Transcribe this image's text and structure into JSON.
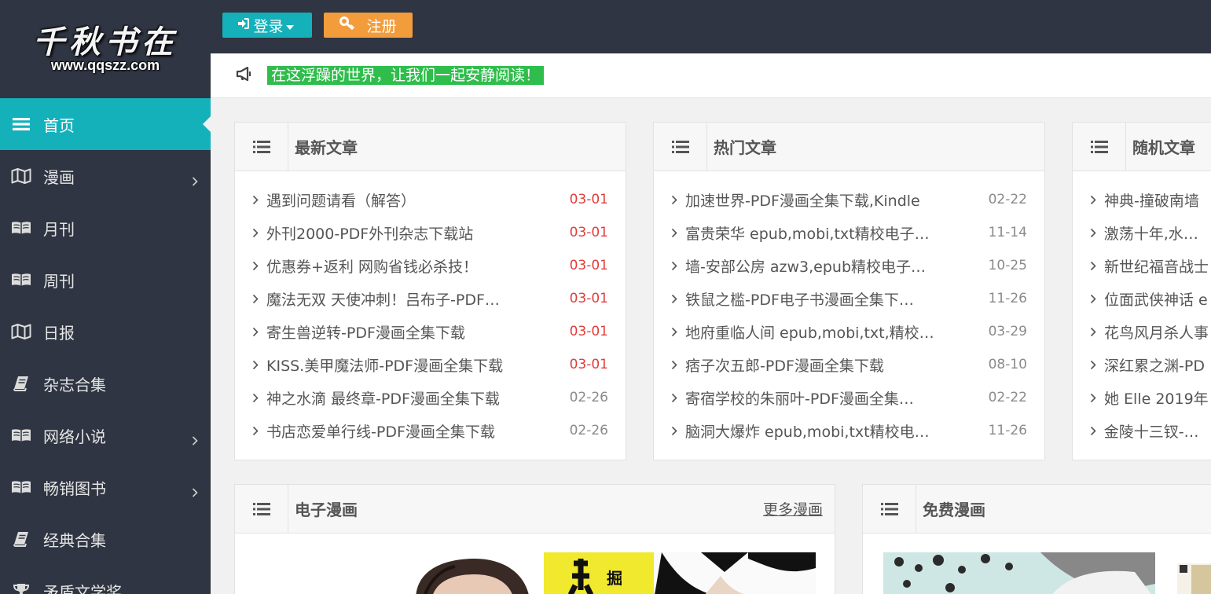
{
  "logo": {
    "title": "千秋书在",
    "url": "www.qqszz.com"
  },
  "sidebar": {
    "items": [
      {
        "label": "首页",
        "icon": "list-icon",
        "active": true,
        "submenu": false
      },
      {
        "label": "漫画",
        "icon": "map-icon",
        "active": false,
        "submenu": true
      },
      {
        "label": "月刊",
        "icon": "book-open-icon",
        "active": false,
        "submenu": false
      },
      {
        "label": "周刊",
        "icon": "book-open-icon",
        "active": false,
        "submenu": false
      },
      {
        "label": "日报",
        "icon": "map-icon",
        "active": false,
        "submenu": false
      },
      {
        "label": "杂志合集",
        "icon": "book-icon",
        "active": false,
        "submenu": false
      },
      {
        "label": "网络小说",
        "icon": "book-open-icon",
        "active": false,
        "submenu": true
      },
      {
        "label": "畅销图书",
        "icon": "book-open-icon",
        "active": false,
        "submenu": true
      },
      {
        "label": "经典合集",
        "icon": "book-icon",
        "active": false,
        "submenu": false
      },
      {
        "label": "矛盾文学奖",
        "icon": "trophy-icon",
        "active": false,
        "submenu": false
      }
    ]
  },
  "header": {
    "login_label": "登录",
    "register_label": "注册"
  },
  "notice": {
    "text": "在这浮躁的世界，让我们一起安静阅读！"
  },
  "panels": {
    "latest": {
      "title": "最新文章",
      "items": [
        {
          "title": "遇到问题请看（解答）",
          "date": "03-01",
          "recent": true
        },
        {
          "title": "外刊2000-PDF外刊杂志下载站",
          "date": "03-01",
          "recent": true
        },
        {
          "title": "优惠券+返利 网购省钱必杀技！",
          "date": "03-01",
          "recent": true
        },
        {
          "title": "魔法无双 天使冲刺！吕布子-PDF…",
          "date": "03-01",
          "recent": true
        },
        {
          "title": "寄生兽逆转-PDF漫画全集下载",
          "date": "03-01",
          "recent": true
        },
        {
          "title": "KISS.美甲魔法师-PDF漫画全集下载",
          "date": "03-01",
          "recent": true
        },
        {
          "title": "神之水滴 最终章-PDF漫画全集下载",
          "date": "02-26",
          "recent": false
        },
        {
          "title": "书店恋爱单行线-PDF漫画全集下载",
          "date": "02-26",
          "recent": false
        }
      ]
    },
    "hot": {
      "title": "热门文章",
      "items": [
        {
          "title": "加速世界-PDF漫画全集下载,Kindle",
          "date": "02-22"
        },
        {
          "title": "富贵荣华 epub,mobi,txt精校电子…",
          "date": "11-14"
        },
        {
          "title": "墙-安部公房 azw3,epub精校电子…",
          "date": "10-25"
        },
        {
          "title": "铁鼠之槛-PDF电子书漫画全集下…",
          "date": "11-26"
        },
        {
          "title": "地府重临人间 epub,mobi,txt,精校…",
          "date": "03-29"
        },
        {
          "title": "痞子次五郎-PDF漫画全集下载",
          "date": "08-10"
        },
        {
          "title": "寄宿学校的朱丽叶-PDF漫画全集…",
          "date": "02-22"
        },
        {
          "title": "脑洞大爆炸 epub,mobi,txt精校电…",
          "date": "11-26"
        }
      ]
    },
    "random": {
      "title": "随机文章",
      "items": [
        {
          "title": "神典-撞破南墙"
        },
        {
          "title": "激荡十年,水大鱼"
        },
        {
          "title": "新世纪福音战士"
        },
        {
          "title": "位面武侠神话 e"
        },
        {
          "title": "花鸟风月杀人事"
        },
        {
          "title": "深红累之渊-PD"
        },
        {
          "title": "她 Elle 2019年"
        },
        {
          "title": "金陵十三钗-严歌"
        }
      ]
    },
    "ecomic": {
      "title": "电子漫画",
      "more": "更多漫画"
    },
    "freecomic": {
      "title": "免费漫画"
    }
  },
  "colors": {
    "accent": "#14b1bb",
    "sidebar_bg": "#2f3542",
    "register": "#f39c3c",
    "notice_bg": "#2fbd4c",
    "date_recent": "#e43b3b"
  }
}
